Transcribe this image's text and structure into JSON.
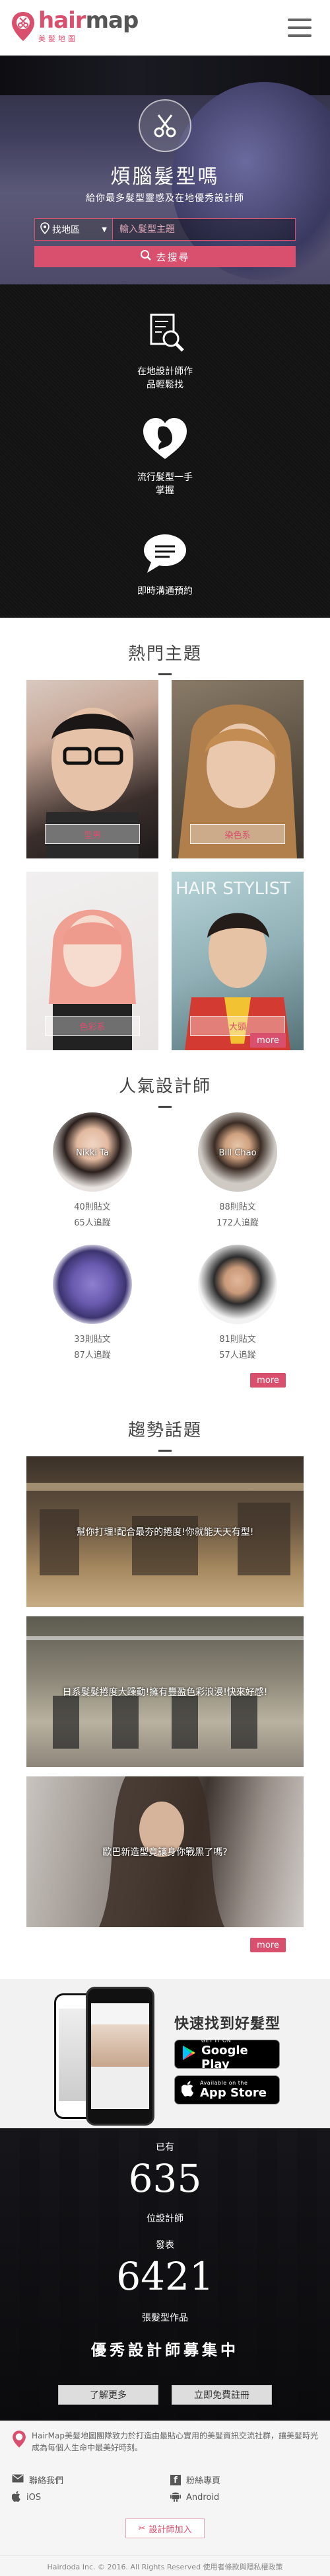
{
  "header": {
    "logo_word_a": "hair",
    "logo_word_b": "map",
    "logo_sub": "美髮地圖"
  },
  "hero": {
    "title": "煩腦髮型嗎",
    "subtitle": "給你最多髮型靈感及在地優秀設計師",
    "location_label": "找地區",
    "search_placeholder": "輸入髮型主題",
    "search_button": "去搜尋"
  },
  "features": [
    {
      "text_1": "在地設計師作",
      "text_2": "品輕鬆找",
      "icon": "search-document-icon"
    },
    {
      "text_1": "流行髮型一手",
      "text_2": "掌握",
      "icon": "hairstyle-heart-icon"
    },
    {
      "text_1": "即時溝通預約",
      "text_2": "",
      "icon": "chat-bubble-icon"
    }
  ],
  "hot_topics": {
    "title": "熱門主題",
    "items": [
      {
        "tag": "型男"
      },
      {
        "tag": "染色系"
      },
      {
        "tag": "色彩系"
      },
      {
        "tag": "大頭"
      }
    ],
    "more": "more"
  },
  "designers": {
    "title": "人氣設計師",
    "items": [
      {
        "name": "Nikki Ta",
        "posts": "40則貼文",
        "followers": "65人追蹤"
      },
      {
        "name": "Bill Chao",
        "posts": "88則貼文",
        "followers": "172人追蹤"
      },
      {
        "name": "",
        "posts": "33則貼文",
        "followers": "87人追蹤"
      },
      {
        "name": "",
        "posts": "81則貼文",
        "followers": "57人追蹤"
      }
    ],
    "more": "more"
  },
  "trends": {
    "title": "趨勢話題",
    "items": [
      {
        "caption": "幫你打理!配合最夯的捲度!你就能天天有型!"
      },
      {
        "caption": "日系髮髮捲度大躁動!擁有豐盈色彩浪漫!快來好感!"
      },
      {
        "caption": "歐巴新造型竟讓身你戰黑了嗎?"
      }
    ],
    "more": "more"
  },
  "app_promo": {
    "title": "快速找到好髮型",
    "google_small": "GET IT ON",
    "google_big": "Google Play",
    "apple_small": "Available on the",
    "apple_big": "App Store"
  },
  "stats": {
    "label_top": "已有",
    "designers_count": "635",
    "designers_label": "位設計師",
    "posts_label_top": "發表",
    "works_count": "6421",
    "works_label": "張髮型作品",
    "recruit_title": "優秀設計師募集中",
    "learn_more": "了解更多",
    "register": "立即免費註冊"
  },
  "footer": {
    "description": "HairMap美髮地圖團隊致力於打造由最貼心實用的美髮資訊交流社群，讓美髮時光成為每個人生命中最美好時刻。",
    "contact": "聯絡我們",
    "fan_page": "粉絲專頁",
    "ios": "iOS",
    "android": "Android",
    "join": "設計師加入",
    "copyright": "Hairdoda Inc. © 2016. All Rights Reserved 使用者條款與隱私權政策"
  }
}
